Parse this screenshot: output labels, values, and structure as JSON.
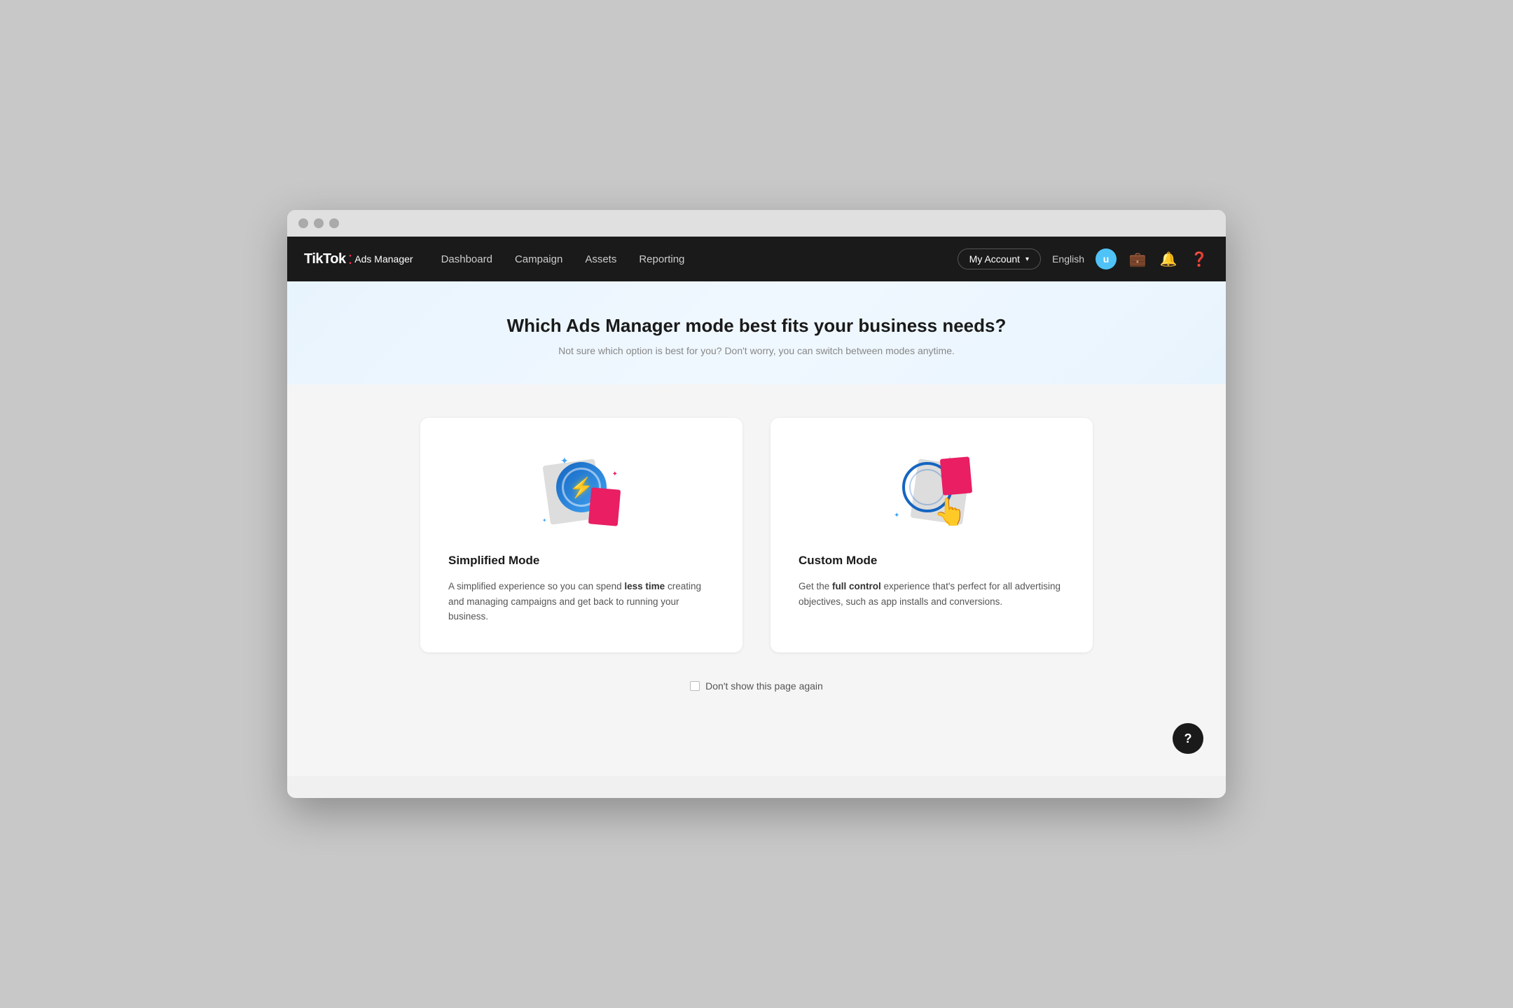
{
  "browser": {
    "traffic_lights": [
      "close",
      "minimize",
      "maximize"
    ]
  },
  "navbar": {
    "brand": {
      "tiktok": "TikTok",
      "dot": ":",
      "ads_manager": "Ads Manager"
    },
    "links": [
      {
        "id": "dashboard",
        "label": "Dashboard"
      },
      {
        "id": "campaign",
        "label": "Campaign"
      },
      {
        "id": "assets",
        "label": "Assets"
      },
      {
        "id": "reporting",
        "label": "Reporting"
      }
    ],
    "account_button": "My Account",
    "language": "English",
    "user_initial": "u"
  },
  "hero": {
    "title": "Which Ads Manager mode best fits your business needs?",
    "subtitle": "Not sure which option is best for you? Don't worry, you can switch between modes anytime."
  },
  "cards": [
    {
      "id": "simplified",
      "title": "Simplified Mode",
      "description_plain": "A simplified experience so you can spend ",
      "description_bold": "less time",
      "description_end": " creating and managing campaigns and get back to running your business."
    },
    {
      "id": "custom",
      "title": "Custom Mode",
      "description_plain": "Get the ",
      "description_bold": "full control",
      "description_end": " experience that's perfect for all advertising objectives, such as app installs and conversions."
    }
  ],
  "footer": {
    "dont_show_label": "Don't show this page again"
  },
  "help": {
    "label": "?"
  }
}
